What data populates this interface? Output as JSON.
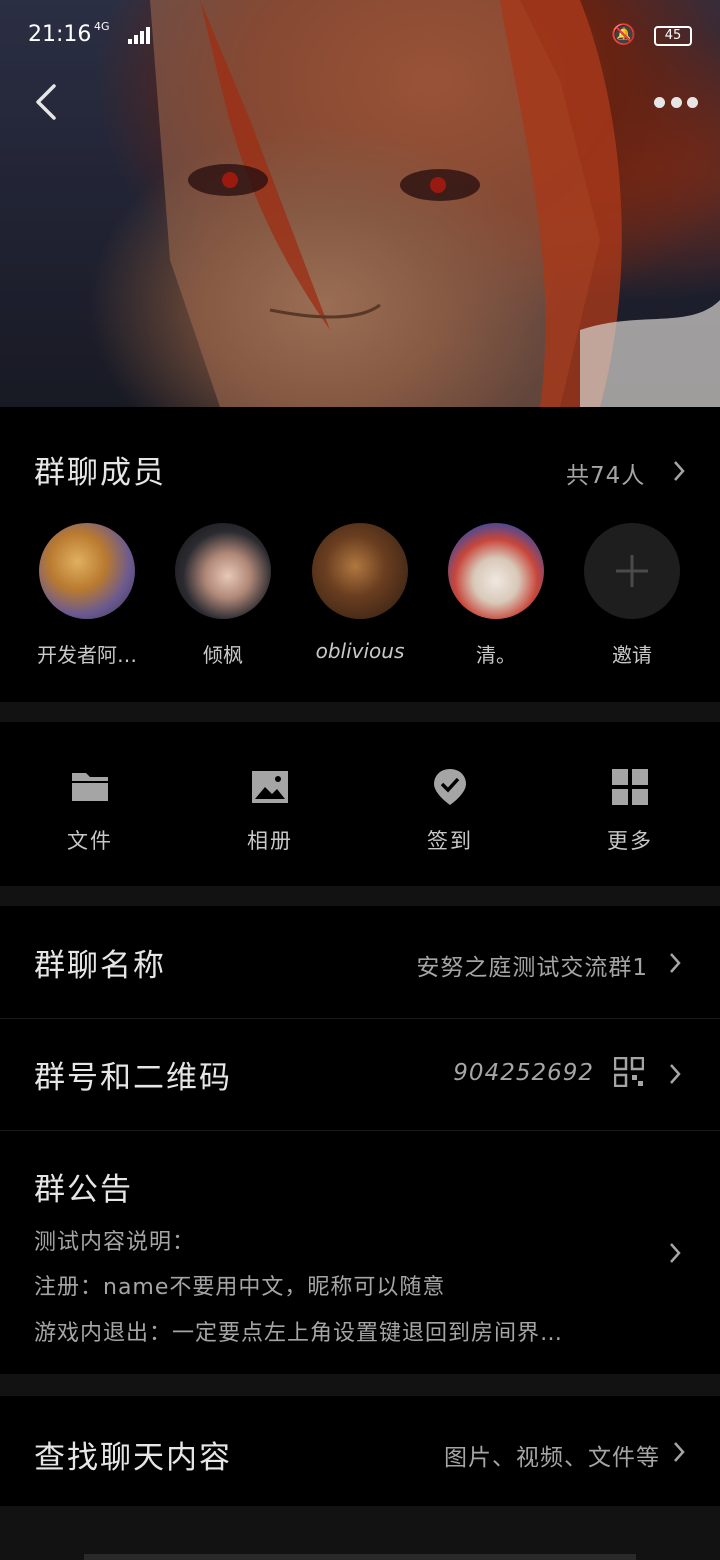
{
  "status_bar": {
    "time": "21:16",
    "network": "4G",
    "battery": "45"
  },
  "members": {
    "title": "群聊成员",
    "count_label": "共74人",
    "items": [
      {
        "name": "开发者阿…"
      },
      {
        "name": "倾枫"
      },
      {
        "name": "oblivious"
      },
      {
        "name": "清。"
      },
      {
        "name": "邀请"
      }
    ]
  },
  "tools": [
    {
      "label": "文件",
      "icon": "folder-icon"
    },
    {
      "label": "相册",
      "icon": "image-icon"
    },
    {
      "label": "签到",
      "icon": "checkin-icon"
    },
    {
      "label": "更多",
      "icon": "grid-icon"
    }
  ],
  "group_name": {
    "title": "群聊名称",
    "value": "安努之庭测试交流群1"
  },
  "group_id": {
    "title": "群号和二维码",
    "value": "904252692"
  },
  "notice": {
    "title": "群公告",
    "lines": [
      "测试内容说明：",
      "注册：name不要用中文，昵称可以随意",
      "游戏内退出：一定要点左上角设置键退回到房间界…"
    ]
  },
  "search": {
    "title": "查找聊天内容",
    "value": "图片、视频、文件等"
  },
  "colors": {
    "background": "#000000",
    "divider": "#121212",
    "text": "#e6e6e6",
    "muted": "#a5a5a5"
  }
}
